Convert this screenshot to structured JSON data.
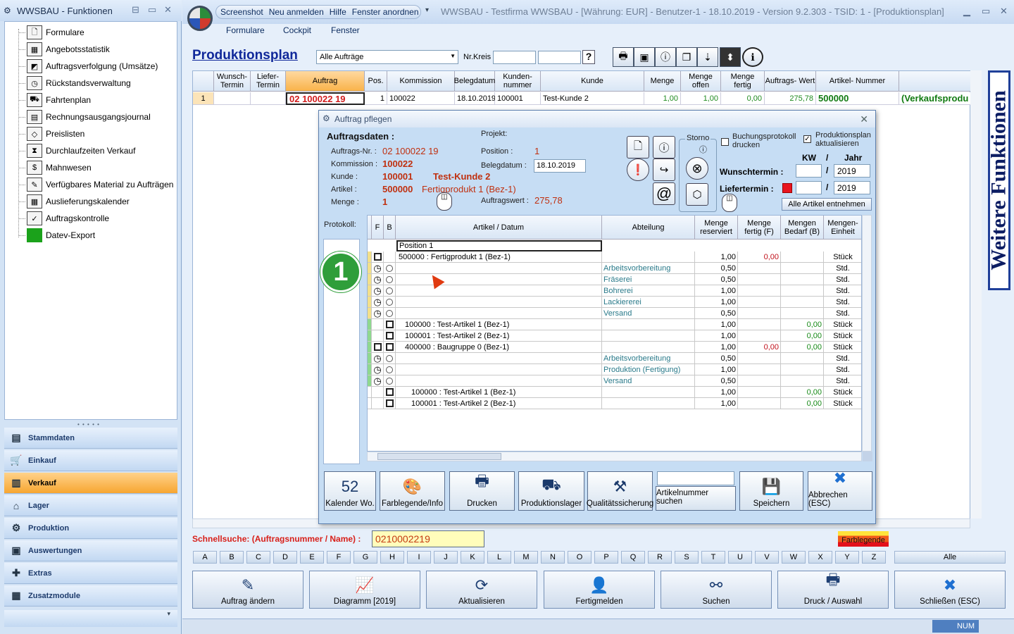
{
  "left_window": {
    "title": "WWSBAU - Funktionen",
    "tree": [
      {
        "icon": "form-icon",
        "label": "Formulare"
      },
      {
        "icon": "statistic-icon",
        "label": "Angebotsstatistik"
      },
      {
        "icon": "order-tracking-icon",
        "label": "Auftragsverfolgung (Umsätze)"
      },
      {
        "icon": "backlog-icon",
        "label": "Rückstandsverwaltung"
      },
      {
        "icon": "truck-icon",
        "label": "Fahrtenplan"
      },
      {
        "icon": "journal-icon",
        "label": "Rechnungsausgangsjournal"
      },
      {
        "icon": "price-tag-icon",
        "label": "Preislisten"
      },
      {
        "icon": "hourglass-icon",
        "label": "Durchlaufzeiten Verkauf"
      },
      {
        "icon": "dunning-icon",
        "label": "Mahnwesen"
      },
      {
        "icon": "material-icon",
        "label": "Verfügbares Material zu Aufträgen"
      },
      {
        "icon": "calendar-icon",
        "label": "Auslieferungskalender"
      },
      {
        "icon": "check-icon",
        "label": "Auftragskontrolle"
      },
      {
        "icon": "datev-icon",
        "label": "Datev-Export"
      }
    ],
    "nav": [
      {
        "icon": "master-data-icon",
        "label": "Stammdaten"
      },
      {
        "icon": "cart-icon",
        "label": "Einkauf"
      },
      {
        "icon": "cash-register-icon",
        "label": "Verkauf"
      },
      {
        "icon": "warehouse-icon",
        "label": "Lager"
      },
      {
        "icon": "production-icon",
        "label": "Produktion"
      },
      {
        "icon": "reports-icon",
        "label": "Auswertungen"
      },
      {
        "icon": "extras-icon",
        "label": "Extras"
      },
      {
        "icon": "modules-icon",
        "label": "Zusatzmodule"
      }
    ]
  },
  "title_bar": {
    "quick": [
      "Screenshot",
      "Neu anmelden",
      "Hilfe",
      "Fenster anordnen"
    ],
    "text": "WWSBAU - Testfirma WWSBAU - [Währung: EUR] - Benutzer-1 - 18.10.2019 - Version 9.2.303 - TSID: 1  - [Produktionsplan]"
  },
  "ribbon": [
    "Formulare",
    "Cockpit",
    "Fenster"
  ],
  "page": {
    "title": "Produktionsplan",
    "filter": "Alle Aufträge",
    "nrkreis_label": "Nr.Kreis",
    "help_label": "?"
  },
  "grid": {
    "headers": [
      "",
      "Wunsch- Termin",
      "Liefer- Termin",
      "Auftrag",
      "Pos.",
      "Kommission",
      "Belegdatum",
      "Kunden- nummer",
      "Kunde",
      "Menge",
      "Menge offen",
      "Menge fertig",
      "Auftrags- Wert",
      "Artikel- Nummer",
      ""
    ],
    "row": [
      "1",
      "",
      "",
      "02 100022 19",
      "1",
      "100022",
      "18.10.2019",
      "100001",
      "Test-Kunde 2",
      "1,00",
      "1,00",
      "0,00",
      "275,78",
      "500000",
      "(Verkaufsprodu"
    ]
  },
  "side_tab": "Weitere Funktionen",
  "dialog": {
    "title": "Auftrag pflegen",
    "section": "Auftragsdaten :",
    "projekt_label": "Projekt:",
    "fields": {
      "auftrags_nr_l": "Auftrags-Nr. :",
      "auftrags_nr": "02 100022 19",
      "kommission_l": "Kommission :",
      "kommission": "100022",
      "kunde_l": "Kunde :",
      "kunde_nr": "100001",
      "kunde_name": "Test-Kunde 2",
      "artikel_l": "Artikel :",
      "artikel_nr": "500000",
      "artikel_name": "Fertigprodukt 1  (Bez-1)",
      "menge_l": "Menge :",
      "menge": "1",
      "position_l": "Position :",
      "position": "1",
      "belegdatum_l": "Belegdatum :",
      "belegdatum": "18.10.2019",
      "auftragswert_l": "Auftragswert :",
      "auftragswert": "275,78"
    },
    "storno": "Storno",
    "buchung": "Buchungsprotokoll drucken",
    "prodplan": "Produktionsplan aktualisieren",
    "kw": "KW",
    "slash": "/",
    "jahr": "Jahr",
    "wunsch_l": "Wunschtermin :",
    "wunsch_year": "2019",
    "liefer_l": "Liefertermin :",
    "liefer_year": "2019",
    "alle_btn": "Alle Artikel entnehmen",
    "protokoll": "Protokoll:",
    "badge": "1",
    "pos_headers": [
      "F",
      "B",
      "Artikel  /  Datum",
      "Abteilung",
      "Menge reserviert",
      "Menge fertig (F)",
      "Mengen Bedarf (B)",
      "Mengen- Einheit"
    ],
    "pos_input": "Position 1",
    "rows": [
      {
        "f": "box",
        "b": "",
        "a": "500000 : Fertigprodukt 1  (Bez-1)",
        "ind": 0,
        "abt": "",
        "mr": "1,00",
        "mf": "0,00",
        "mb": "",
        "e": "Stück",
        "bar": "#f3e08a"
      },
      {
        "f": "clock",
        "b": "circle",
        "a": "",
        "ind": 0,
        "abt": "Arbeitsvorbereitung",
        "mr": "0,50",
        "mf": "",
        "mb": "",
        "e": "Std.",
        "bar": "#f3e08a"
      },
      {
        "f": "clock",
        "b": "circle",
        "a": "",
        "ind": 0,
        "abt": "Fräserei",
        "mr": "0,50",
        "mf": "",
        "mb": "",
        "e": "Std.",
        "bar": "#f3e08a"
      },
      {
        "f": "clock",
        "b": "circle",
        "a": "",
        "ind": 0,
        "abt": "Bohrerei",
        "mr": "1,00",
        "mf": "",
        "mb": "",
        "e": "Std.",
        "bar": "#f3e08a"
      },
      {
        "f": "clock",
        "b": "circle",
        "a": "",
        "ind": 0,
        "abt": "Lackiererei",
        "mr": "1,00",
        "mf": "",
        "mb": "",
        "e": "Std.",
        "bar": "#f3e08a"
      },
      {
        "f": "clock",
        "b": "circle",
        "a": "",
        "ind": 0,
        "abt": "Versand",
        "mr": "0,50",
        "mf": "",
        "mb": "",
        "e": "Std.",
        "bar": "#f3e08a"
      },
      {
        "f": "",
        "b": "box",
        "a": "100000 : Test-Artikel 1  (Bez-1)",
        "ind": 1,
        "abt": "",
        "mr": "1,00",
        "mf": "",
        "mb": "0,00",
        "e": "Stück",
        "bar": "#8fd88f"
      },
      {
        "f": "",
        "b": "box",
        "a": "100001 : Test-Artikel 2  (Bez-1)",
        "ind": 1,
        "abt": "",
        "mr": "1,00",
        "mf": "",
        "mb": "0,00",
        "e": "Stück",
        "bar": "#8fd88f"
      },
      {
        "f": "box",
        "b": "box",
        "a": "400000 : Baugruppe 0  (Bez-1)",
        "ind": 1,
        "abt": "",
        "mr": "1,00",
        "mf": "0,00",
        "mb": "0,00",
        "e": "Stück",
        "bar": "#8fd88f"
      },
      {
        "f": "clock",
        "b": "circle",
        "a": "",
        "ind": 1,
        "abt": "Arbeitsvorbereitung",
        "mr": "0,50",
        "mf": "",
        "mb": "",
        "e": "Std.",
        "bar": "#8fd88f"
      },
      {
        "f": "clock",
        "b": "circle",
        "a": "",
        "ind": 1,
        "abt": "Produktion (Fertigung)",
        "mr": "1,00",
        "mf": "",
        "mb": "",
        "e": "Std.",
        "bar": "#8fd88f"
      },
      {
        "f": "clock",
        "b": "circle",
        "a": "",
        "ind": 1,
        "abt": "Versand",
        "mr": "0,50",
        "mf": "",
        "mb": "",
        "e": "Std.",
        "bar": "#8fd88f"
      },
      {
        "f": "",
        "b": "box",
        "a": "100000 : Test-Artikel 1  (Bez-1)",
        "ind": 2,
        "abt": "",
        "mr": "1,00",
        "mf": "",
        "mb": "0,00",
        "e": "Stück",
        "bar": "#ffffff"
      },
      {
        "f": "",
        "b": "box",
        "a": "100001 : Test-Artikel 2  (Bez-1)",
        "ind": 2,
        "abt": "",
        "mr": "1,00",
        "mf": "",
        "mb": "0,00",
        "e": "Stück",
        "bar": "#ffffff"
      }
    ],
    "buttons": [
      {
        "icon": "calendar-icon",
        "glyph": "52",
        "label": "Kalender Wo."
      },
      {
        "icon": "palette-icon",
        "glyph": "🎨",
        "label": "Farblegende/Info"
      },
      {
        "icon": "printer-icon",
        "glyph": "🖶",
        "label": "Drucken"
      },
      {
        "icon": "warehouse-icon",
        "glyph": "⛟",
        "label": "Produktionslager"
      },
      {
        "icon": "caliper-icon",
        "glyph": "⚒",
        "label": "Qualitätssicherung"
      }
    ],
    "search_btn": "Artikelnummer suchen",
    "save_btn": "Speichern",
    "cancel_btn": "Abbrechen (ESC)"
  },
  "schnellsuche": {
    "label": "Schnellsuche: (Auftragsnummer / Name) :",
    "value": "0210002219",
    "legend": "Farblegende"
  },
  "alphabet": [
    "A",
    "B",
    "C",
    "D",
    "E",
    "F",
    "G",
    "H",
    "I",
    "J",
    "K",
    "L",
    "M",
    "N",
    "O",
    "P",
    "Q",
    "R",
    "S",
    "T",
    "U",
    "V",
    "W",
    "X",
    "Y",
    "Z"
  ],
  "alle": "Alle",
  "bottom_buttons": [
    {
      "icon": "edit-order-icon",
      "glyph": "✎",
      "label": "Auftrag ändern"
    },
    {
      "icon": "chart-icon",
      "glyph": "📈",
      "label": "Diagramm [2019]"
    },
    {
      "icon": "refresh-icon",
      "glyph": "⟳",
      "label": "Aktualisieren"
    },
    {
      "icon": "user-check-icon",
      "glyph": "👤",
      "label": "Fertigmelden"
    },
    {
      "icon": "binoculars-icon",
      "glyph": "⚯",
      "label": "Suchen"
    },
    {
      "icon": "printer-icon",
      "glyph": "🖶",
      "label": "Druck / Auswahl"
    },
    {
      "icon": "close-icon",
      "glyph": "✖",
      "label": "Schließen (ESC)"
    }
  ],
  "status": {
    "num": "NUM"
  }
}
